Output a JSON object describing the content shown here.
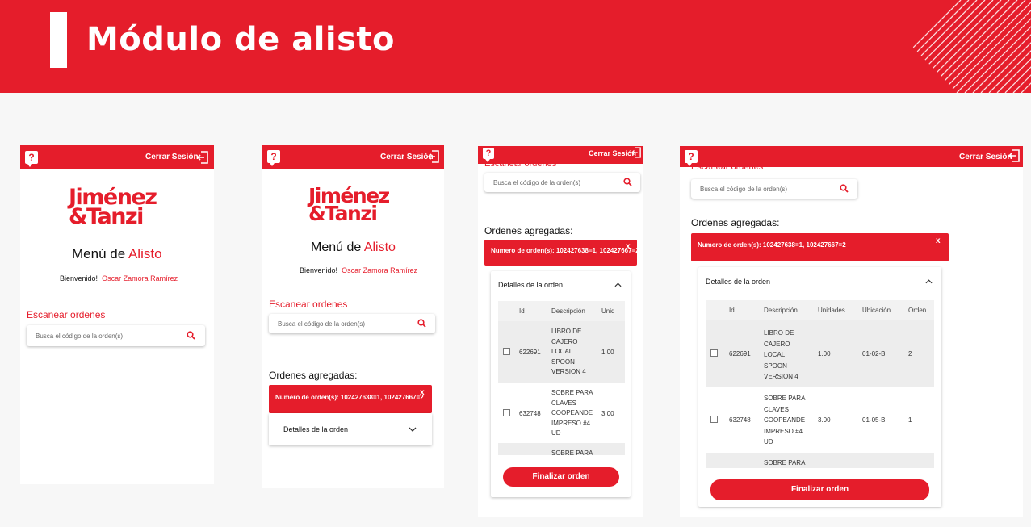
{
  "header": {
    "title": "Módulo de alisto"
  },
  "app": {
    "help_icon": "?",
    "logout_label": "Cerrar Sesión",
    "logo_line1": "Jiménez",
    "logo_line2": "&Tanzi",
    "menu_prefix": "Menú de",
    "menu_highlight": "Alisto",
    "welcome_label": "Bienvenido!",
    "user_name": "Oscar Zamora Ramírez",
    "scan_label": "Escanear ordenes",
    "search_placeholder": "Busca el código de la orden(s)",
    "added_label": "Ordenes agregadas:",
    "chip_text": "Numero de orden(s): 102427638=1, 102427667=2",
    "chip_close": "x",
    "details_label": "Detalles de la orden",
    "finalize_label": "Finalizar orden"
  },
  "table": {
    "columns": [
      "Id",
      "Descripción",
      "Unidades",
      "Ubicación",
      "Orden"
    ],
    "columns_narrow": [
      "Id",
      "Descripción",
      "Unid"
    ],
    "rows": [
      {
        "id": "622691",
        "desc": [
          "LIBRO DE",
          "CAJERO",
          "LOCAL",
          "SPOON",
          "VERSION 4"
        ],
        "units": "1.00",
        "location": "01-02-B",
        "order": "2"
      },
      {
        "id": "632748",
        "desc": [
          "SOBRE PARA",
          "CLAVES",
          "COOPEANDE",
          "IMPRESO #4",
          "UD"
        ],
        "units": "3.00",
        "location": "01-05-B",
        "order": "1"
      },
      {
        "id": "",
        "desc": [
          "SOBRE PARA"
        ],
        "units": "",
        "location": "",
        "order": ""
      }
    ]
  },
  "colors": {
    "brand_red": "#e51d2b",
    "background": "#ffffff",
    "panel_gray": "#f7f7f7"
  },
  "icons": {
    "help": "question-icon",
    "logout": "logout-icon",
    "search": "search-icon",
    "chevron_down": "chevron-down-icon",
    "chevron_up": "chevron-up-icon"
  }
}
